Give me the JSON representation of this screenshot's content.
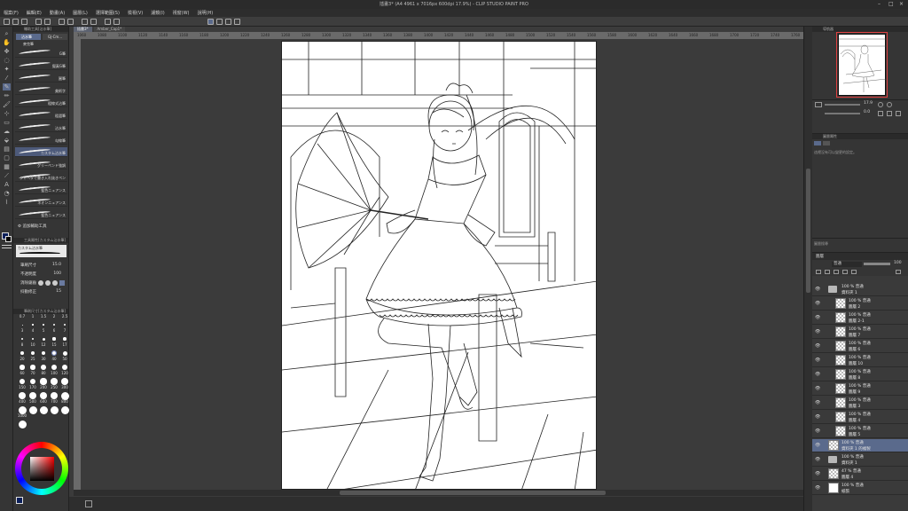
{
  "app": {
    "title": "插畫3* (A4 4961 x 7016px 600dpi 17.9%) - CLIP STUDIO PAINT PRO"
  },
  "menu": [
    "檔案(F)",
    "編輯(E)",
    "動畫(A)",
    "圖層(L)",
    "選擇範圍(S)",
    "檢視(V)",
    "濾鏡(I)",
    "視窗(W)",
    "說明(H)"
  ],
  "tabs": [
    "插畫3*",
    "Amber_Cap1*"
  ],
  "ruler_ticks": [
    "1060",
    "1080",
    "1100",
    "1120",
    "1140",
    "1160",
    "1180",
    "1200",
    "1220",
    "1240",
    "1260",
    "1280",
    "1300",
    "1320",
    "1340",
    "1360",
    "1380",
    "1400",
    "1420",
    "1440",
    "1460",
    "1480",
    "1500",
    "1520",
    "1540",
    "1560",
    "1580",
    "1600",
    "1620",
    "1640",
    "1660",
    "1680",
    "1700",
    "1720",
    "1740",
    "1760"
  ],
  "subtool": {
    "header": "輔助工具[沾水筆]",
    "tab_active": "沾水筆",
    "tab_other": "GJ-Cm...",
    "group": "麥克筆",
    "brushes": [
      {
        "label": "G筆",
        "selected": false
      },
      {
        "label": "擬真G筆",
        "selected": false
      },
      {
        "label": "圓筆",
        "selected": false
      },
      {
        "label": "美術字",
        "selected": false
      },
      {
        "label": "粗線式沾筆",
        "selected": false
      },
      {
        "label": "粗澀筆",
        "selected": false
      },
      {
        "label": "沾水筆",
        "selected": false
      },
      {
        "label": "勾線筆",
        "selected": false
      },
      {
        "label": "カスタム沾水筆",
        "selected": true
      },
      {
        "label": "グリーペンド強調",
        "selected": false
      },
      {
        "label": "ジャベタで書き入れ抜きペン",
        "selected": false
      },
      {
        "label": "藍色ニュアンス",
        "selected": false
      },
      {
        "label": "ネオンニュアンス",
        "selected": false
      },
      {
        "label": "藍色ニュアンス",
        "selected": false
      }
    ],
    "add_button": "追加輔助工具"
  },
  "tool_property": {
    "header": "工具屬性[カスタム沾水筆]",
    "preview": "カスタム沾水筆",
    "rows": [
      {
        "label": "筆刷尺寸",
        "value": "15.0"
      },
      {
        "label": "不透明度",
        "value": "100"
      },
      {
        "label": "消除鋸齒",
        "value": ""
      },
      {
        "label": "抖動修正",
        "value": "15"
      }
    ]
  },
  "brush_size": {
    "header": "筆刷尺寸[カスタム沾水筆]",
    "labels": [
      "0.7",
      "1",
      "1.5",
      "2",
      "2.5",
      "3",
      "4",
      "5",
      "6",
      "7",
      "8",
      "10",
      "12",
      "15",
      "17",
      "20",
      "25",
      "30",
      "40",
      "50",
      "60",
      "70",
      "80",
      "100",
      "120",
      "150",
      "170",
      "200",
      "250",
      "300",
      "400",
      "500",
      "600",
      "700",
      "800",
      "1000"
    ]
  },
  "navigator": {
    "header": "導航器",
    "zoom": "17.9",
    "angle": "0.0"
  },
  "layer_property": {
    "header": "圖層屬性",
    "note": "這裡沒有可以變更的設定。"
  },
  "search": {
    "label": "圖層搜尋"
  },
  "layer_panel": {
    "header": "圖層",
    "blend_mode": "普通",
    "opacity": "100",
    "layers": [
      {
        "top": "100 % 普通",
        "name": "資料夾 1",
        "kind": "folder",
        "indent": 18,
        "selected": false
      },
      {
        "top": "100 % 普通",
        "name": "圖層 2",
        "kind": "layer",
        "indent": 26,
        "selected": false
      },
      {
        "top": "100 % 普通",
        "name": "圖層 2-1",
        "kind": "layer",
        "indent": 26,
        "selected": false
      },
      {
        "top": "100 % 普通",
        "name": "圖層 7",
        "kind": "layer",
        "indent": 26,
        "selected": false
      },
      {
        "top": "100 % 普通",
        "name": "圖層 6",
        "kind": "layer",
        "indent": 26,
        "selected": false
      },
      {
        "top": "100 % 普通",
        "name": "圖層 10",
        "kind": "layer",
        "indent": 26,
        "selected": false
      },
      {
        "top": "100 % 普通",
        "name": "圖層 8",
        "kind": "layer",
        "indent": 26,
        "selected": false
      },
      {
        "top": "100 % 普通",
        "name": "圖層 9",
        "kind": "layer",
        "indent": 26,
        "selected": false
      },
      {
        "top": "100 % 普通",
        "name": "圖層 3",
        "kind": "layer",
        "indent": 26,
        "selected": false
      },
      {
        "top": "100 % 普通",
        "name": "圖層 4",
        "kind": "layer",
        "indent": 26,
        "selected": false
      },
      {
        "top": "100 % 普通",
        "name": "圖層 5",
        "kind": "layer",
        "indent": 26,
        "selected": false
      },
      {
        "top": "100 % 普通",
        "name": "資料夾 1 的複製",
        "kind": "layer",
        "indent": 18,
        "selected": true
      },
      {
        "top": "100 % 普通",
        "name": "資料夾 1",
        "kind": "folder",
        "indent": 18,
        "selected": false
      },
      {
        "top": "47 % 普通",
        "name": "圖層 4",
        "kind": "layer",
        "indent": 18,
        "selected": false
      },
      {
        "top": "100 % 普通",
        "name": "紙張",
        "kind": "paper",
        "indent": 18,
        "selected": false
      }
    ]
  }
}
